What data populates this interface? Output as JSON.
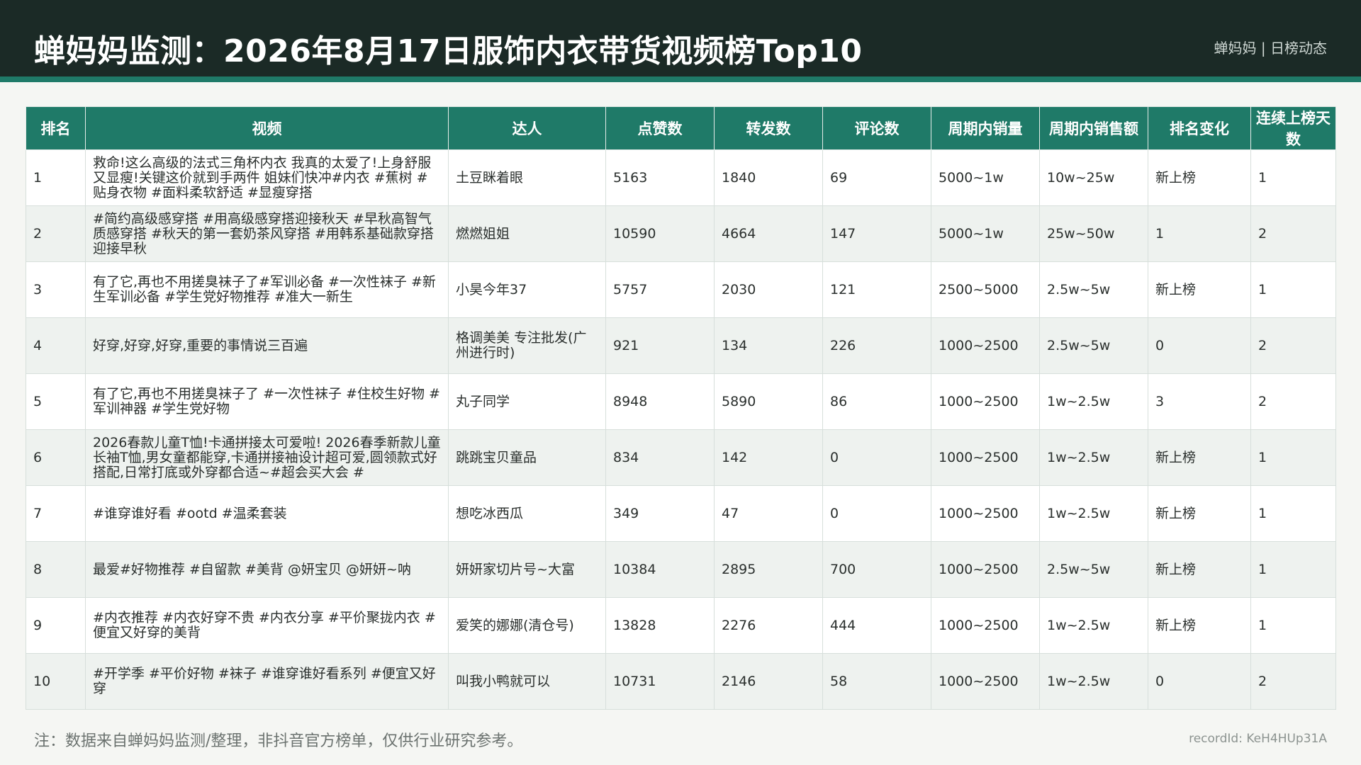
{
  "header": {
    "title": "蝉妈妈监测：2026年8月17日服饰内衣带货视频榜Top10",
    "brand": "蝉妈妈 | 日榜动态"
  },
  "table": {
    "columns": [
      "排名",
      "视频",
      "达人",
      "点赞数",
      "转发数",
      "评论数",
      "周期内销量",
      "周期内销售额",
      "排名变化",
      "连续上榜天数"
    ],
    "rows": [
      [
        "1",
        "救命!这么高级的法式三角杯内衣 我真的太爱了!上身舒服又显瘦!关键这价就到手两件 姐妹们快冲#内衣 #蕉树 #贴身衣物 #面料柔软舒适 #显瘦穿搭",
        "土豆眯着眼",
        "5163",
        "1840",
        "69",
        "5000~1w",
        "10w~25w",
        "新上榜",
        "1"
      ],
      [
        "2",
        "#简约高级感穿搭 #用高级感穿搭迎接秋天 #早秋高智气质感穿搭 #秋天的第一套奶茶风穿搭 #用韩系基础款穿搭迎接早秋",
        "燃燃姐姐",
        "10590",
        "4664",
        "147",
        "5000~1w",
        "25w~50w",
        "1",
        "2"
      ],
      [
        "3",
        "有了它,再也不用搓臭袜子了#军训必备 #一次性袜子 #新生军训必备 #学生党好物推荐 #准大一新生",
        "小昊今年37",
        "5757",
        "2030",
        "121",
        "2500~5000",
        "2.5w~5w",
        "新上榜",
        "1"
      ],
      [
        "4",
        "好穿,好穿,好穿,重要的事情说三百遍",
        "格调美美 专注批发(广州进行时)",
        "921",
        "134",
        "226",
        "1000~2500",
        "2.5w~5w",
        "0",
        "2"
      ],
      [
        "5",
        "有了它,再也不用搓臭袜子了 #一次性袜子 #住校生好物 #军训神器 #学生党好物",
        "丸子同学",
        "8948",
        "5890",
        "86",
        "1000~2500",
        "1w~2.5w",
        "3",
        "2"
      ],
      [
        "6",
        "2026春款儿童T恤!卡通拼接太可爱啦! 2026春季新款儿童长袖T恤,男女童都能穿,卡通拼接袖设计超可爱,圆领款式好搭配,日常打底或外穿都合适~#超会买大会 #",
        "跳跳宝贝童品",
        "834",
        "142",
        "0",
        "1000~2500",
        "1w~2.5w",
        "新上榜",
        "1"
      ],
      [
        "7",
        "#谁穿谁好看 #ootd #温柔套装",
        "想吃冰西瓜",
        "349",
        "47",
        "0",
        "1000~2500",
        "1w~2.5w",
        "新上榜",
        "1"
      ],
      [
        "8",
        "最爱#好物推荐 #自留款 #美背 @妍宝贝 @妍妍~呐",
        "妍妍家切片号~大富",
        "10384",
        "2895",
        "700",
        "1000~2500",
        "2.5w~5w",
        "新上榜",
        "1"
      ],
      [
        "9",
        "#内衣推荐 #内衣好穿不贵 #内衣分享 #平价聚拢内衣 #便宜又好穿的美背",
        "爱笑的娜娜(清仓号)",
        "13828",
        "2276",
        "444",
        "1000~2500",
        "1w~2.5w",
        "新上榜",
        "1"
      ],
      [
        "10",
        "#开学季 #平价好物 #袜子 #谁穿谁好看系列 #便宜又好穿",
        "叫我小鸭就可以",
        "10731",
        "2146",
        "58",
        "1000~2500",
        "1w~2.5w",
        "0",
        "2"
      ]
    ]
  },
  "footer": {
    "note": "注：数据来自蝉妈妈监测/整理，非抖音官方榜单，仅供行业研究参考。",
    "record": "recordId: KeH4HUp31A"
  }
}
